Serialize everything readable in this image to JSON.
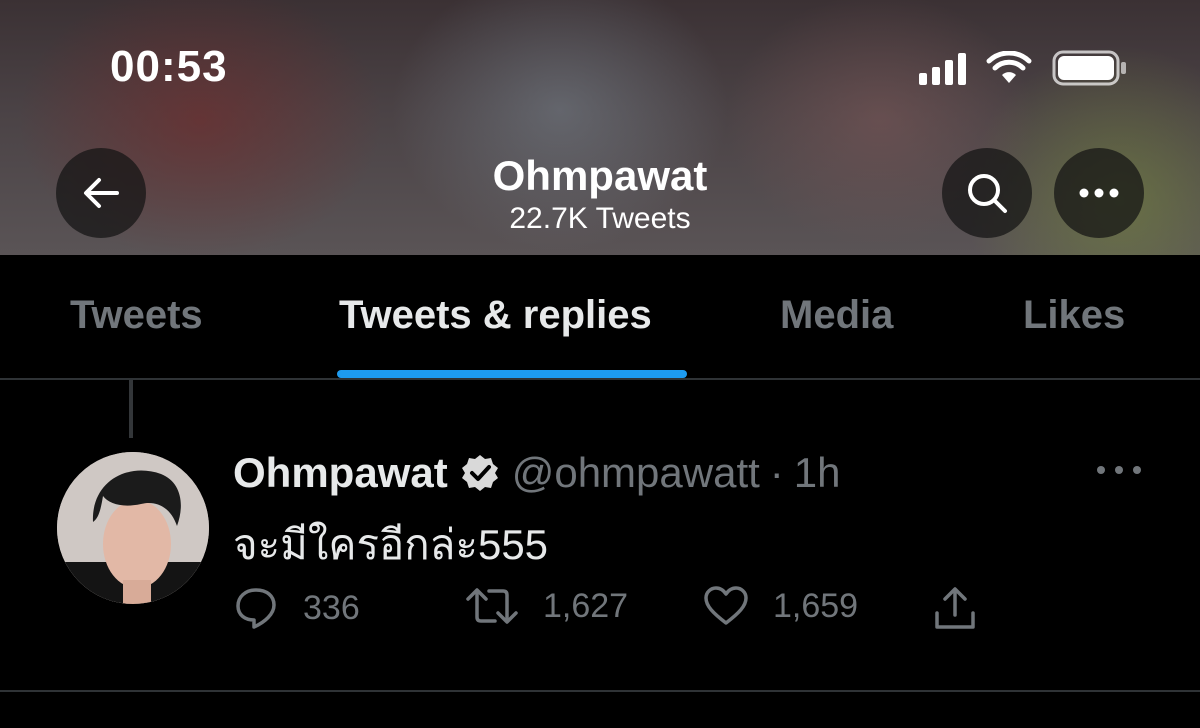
{
  "status_bar": {
    "time": "00:53",
    "icons": [
      "cellular-signal-icon",
      "wifi-icon",
      "battery-icon"
    ]
  },
  "header": {
    "title": "Ohmpawat",
    "subtitle": "22.7K Tweets",
    "back_icon": "arrow-left-icon",
    "search_icon": "search-icon",
    "more_icon": "more-horizontal-icon"
  },
  "tabs": [
    {
      "label": "Tweets",
      "active": false
    },
    {
      "label": "Tweets & replies",
      "active": true
    },
    {
      "label": "Media",
      "active": false
    },
    {
      "label": "Likes",
      "active": false
    }
  ],
  "tweet": {
    "name": "Ohmpawat",
    "verified": true,
    "handle": "@ohmpawatt",
    "separator": "·",
    "time": "1h",
    "text": "จะมีใครอีกล่ะ555",
    "replies": "336",
    "retweets": "1,627",
    "likes": "1,659"
  },
  "colors": {
    "background": "#000000",
    "accent": "#1d9bf0",
    "muted_text": "#71767b",
    "primary_text": "#e7e9ea"
  }
}
